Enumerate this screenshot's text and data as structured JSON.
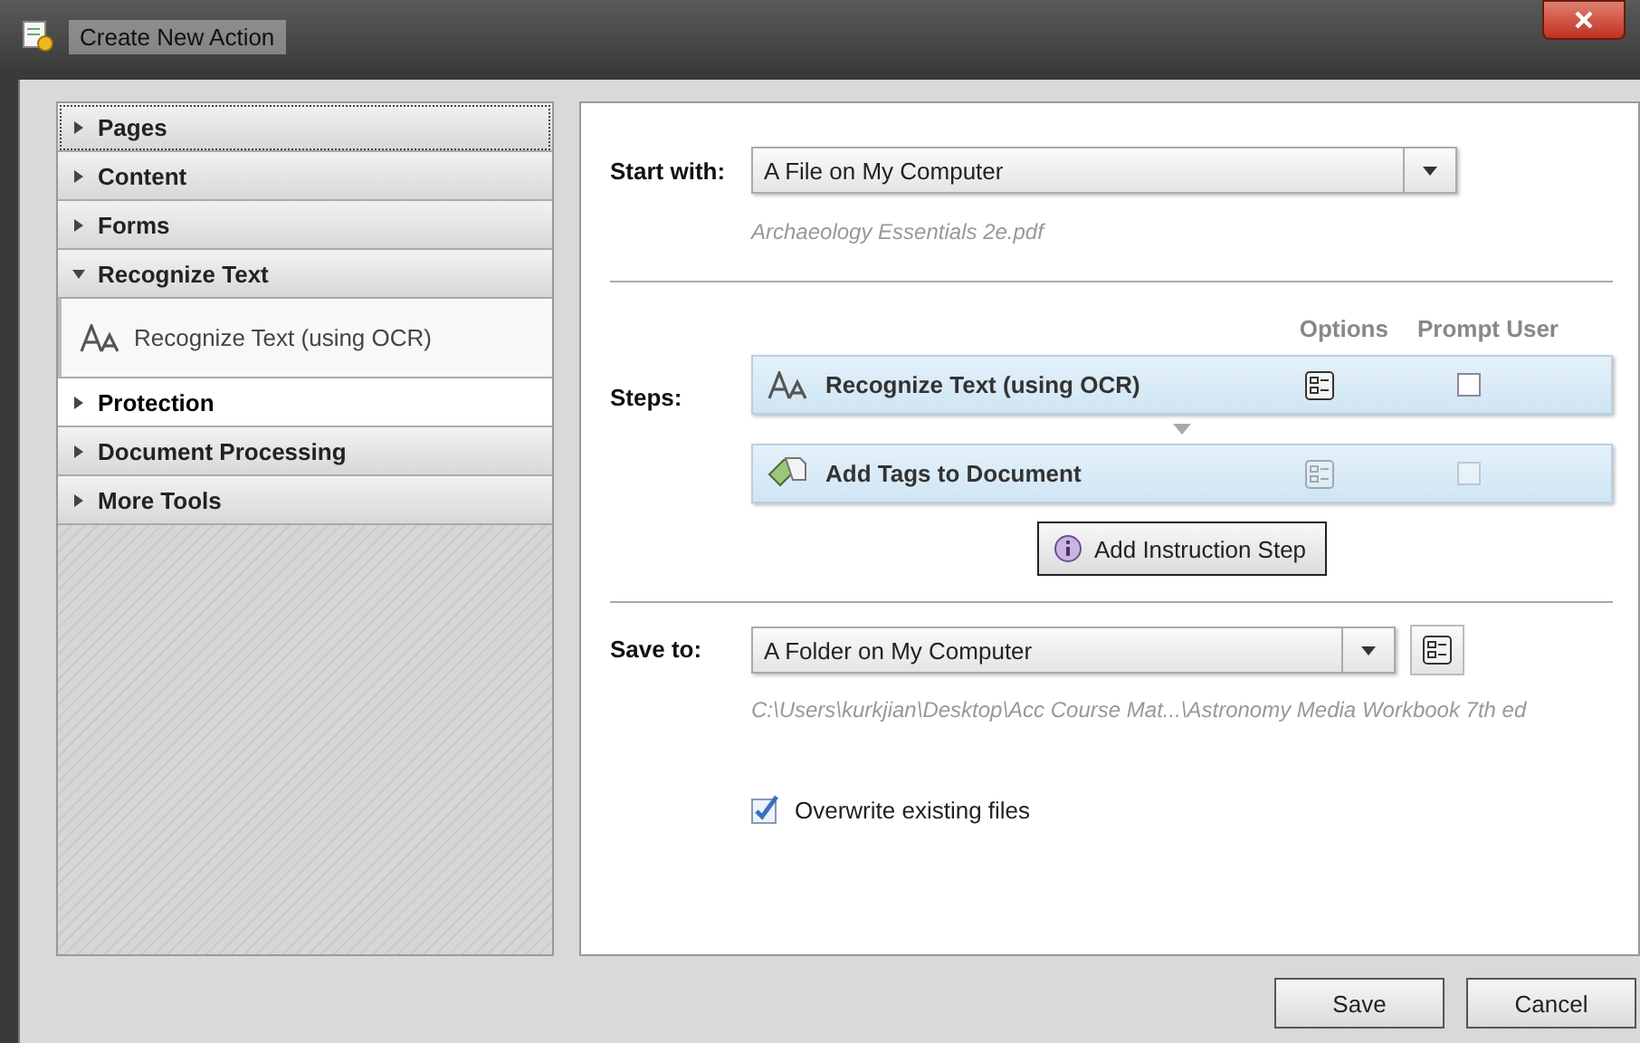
{
  "window": {
    "title": "Create New Action"
  },
  "categories": [
    {
      "label": "Pages",
      "expanded": false,
      "selected": false,
      "focused": true
    },
    {
      "label": "Content",
      "expanded": false,
      "selected": false,
      "focused": false
    },
    {
      "label": "Forms",
      "expanded": false,
      "selected": false,
      "focused": false
    },
    {
      "label": "Recognize Text",
      "expanded": true,
      "selected": false,
      "focused": false,
      "children": [
        {
          "label": "Recognize Text (using OCR)"
        }
      ]
    },
    {
      "label": "Protection",
      "expanded": false,
      "selected": true,
      "focused": false
    },
    {
      "label": "Document Processing",
      "expanded": false,
      "selected": false,
      "focused": false
    },
    {
      "label": "More Tools",
      "expanded": false,
      "selected": false,
      "focused": false
    }
  ],
  "start_with": {
    "label": "Start with:",
    "value": "A File on My Computer",
    "file": "Archaeology Essentials 2e.pdf"
  },
  "steps": {
    "label": "Steps:",
    "columns": [
      "Options",
      "Prompt User"
    ],
    "items": [
      {
        "kind": "ocr",
        "label": "Recognize Text (using OCR)",
        "disabled": false,
        "prompt_user": false
      },
      {
        "kind": "tags",
        "label": "Add Tags to Document",
        "disabled": true,
        "prompt_user": false
      }
    ],
    "add_button": "Add Instruction Step"
  },
  "save_to": {
    "label": "Save to:",
    "value": "A Folder on My Computer",
    "path": "C:\\Users\\kurkjian\\Desktop\\Acc Course Mat...\\Astronomy Media Workbook 7th ed",
    "overwrite_label": "Overwrite existing files",
    "overwrite": true
  },
  "buttons": [
    "Save",
    "Cancel"
  ]
}
